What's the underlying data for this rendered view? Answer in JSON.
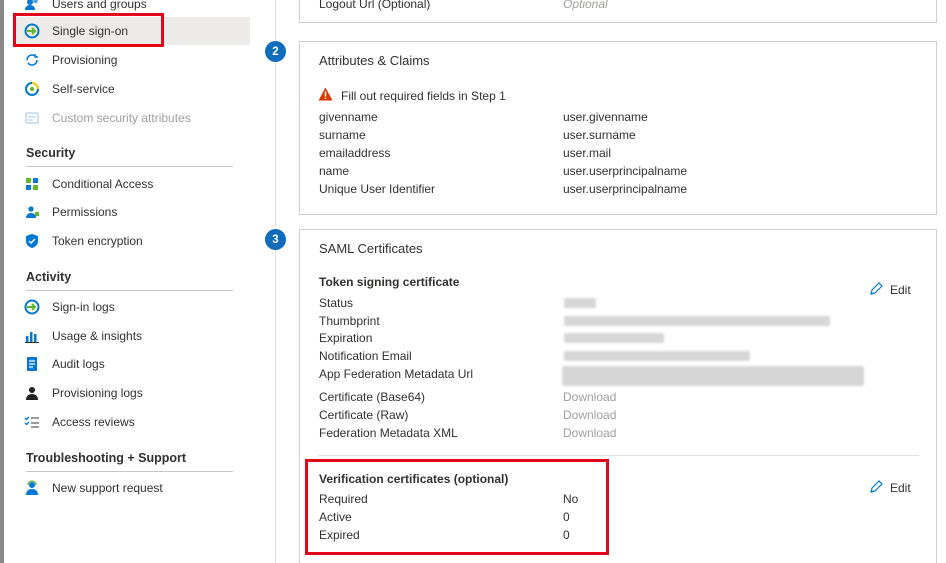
{
  "sidebar": {
    "items_top": [
      {
        "label": "Users and groups",
        "icon": "users-icon"
      },
      {
        "label": "Single sign-on",
        "icon": "sso-icon"
      },
      {
        "label": "Provisioning",
        "icon": "provisioning-icon"
      },
      {
        "label": "Self-service",
        "icon": "self-service-icon"
      },
      {
        "label": "Custom security attributes",
        "icon": "custom-attributes-icon"
      }
    ],
    "security": {
      "heading": "Security",
      "items": [
        {
          "label": "Conditional Access",
          "icon": "conditional-access-icon"
        },
        {
          "label": "Permissions",
          "icon": "permissions-icon"
        },
        {
          "label": "Token encryption",
          "icon": "shield-icon"
        }
      ]
    },
    "activity": {
      "heading": "Activity",
      "items": [
        {
          "label": "Sign-in logs",
          "icon": "sign-in-logs-icon"
        },
        {
          "label": "Usage & insights",
          "icon": "bar-chart-icon"
        },
        {
          "label": "Audit logs",
          "icon": "audit-logs-icon"
        },
        {
          "label": "Provisioning logs",
          "icon": "person-icon"
        },
        {
          "label": "Access reviews",
          "icon": "checklist-icon"
        }
      ]
    },
    "troubleshooting": {
      "heading": "Troubleshooting + Support",
      "items": [
        {
          "label": "New support request",
          "icon": "support-icon"
        }
      ]
    }
  },
  "top_partial": {
    "label": "Logout Url (Optional)",
    "value": "Optional"
  },
  "attributes_claims": {
    "step": "2",
    "title": "Attributes & Claims",
    "warning": "Fill out required fields in Step 1",
    "rows": [
      {
        "name": "givenname",
        "value": "user.givenname"
      },
      {
        "name": "surname",
        "value": "user.surname"
      },
      {
        "name": "emailaddress",
        "value": "user.mail"
      },
      {
        "name": "name",
        "value": "user.userprincipalname"
      },
      {
        "name": "Unique User Identifier",
        "value": "user.userprincipalname"
      }
    ]
  },
  "saml_certificates": {
    "step": "3",
    "title": "SAML Certificates",
    "token_signing": {
      "heading": "Token signing certificate",
      "edit_label": "Edit",
      "rows": [
        "Status",
        "Thumbprint",
        "Expiration",
        "Notification Email",
        "App Federation Metadata Url"
      ],
      "downloads": [
        {
          "name": "Certificate (Base64)",
          "action": "Download"
        },
        {
          "name": "Certificate (Raw)",
          "action": "Download"
        },
        {
          "name": "Federation Metadata XML",
          "action": "Download"
        }
      ]
    },
    "verification": {
      "heading": "Verification certificates (optional)",
      "edit_label": "Edit",
      "rows": [
        {
          "name": "Required",
          "value": "No"
        },
        {
          "name": "Active",
          "value": "0"
        },
        {
          "name": "Expired",
          "value": "0"
        }
      ]
    }
  },
  "colors": {
    "accent": "#0f6cbd",
    "highlight_box": "#e3061a",
    "warning": "#d83b01"
  }
}
